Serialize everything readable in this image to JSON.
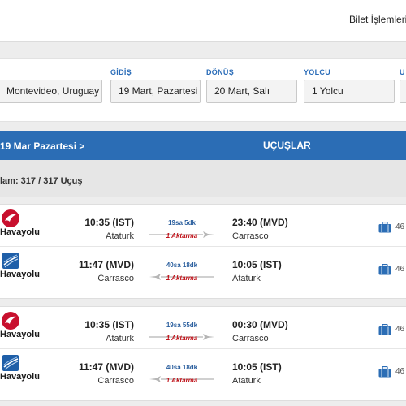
{
  "header": {
    "menu_label": "Bilet İşlemleri"
  },
  "search": {
    "from": {
      "value": "Montevideo, Uruguay (Carrasco)"
    },
    "depart": {
      "label": "GİDİŞ",
      "value": "19 Mart, Pazartesi"
    },
    "return": {
      "label": "DÖNÜŞ",
      "value": "20 Mart, Salı"
    },
    "passengers": {
      "label": "YOLCU",
      "value": "1 Yolcu"
    },
    "extra": {
      "label": "U"
    }
  },
  "results_header": {
    "date_text": "19 Mar Pazartesi  >",
    "title": "UÇUŞLAR"
  },
  "count_text": "lam: 317 / 317 Uçuş",
  "colors": {
    "brand_blue": "#2b6db5",
    "label_blue": "#2a6cb8",
    "stops_red": "#c0131a",
    "turkish_red": "#c8102e",
    "partner_blue": "#1f5fa8"
  },
  "cards": [
    {
      "legs": [
        {
          "airline": "Havayolu",
          "logo": "turkish-airlines-logo",
          "dep_time": "10:35 (IST)",
          "dep_city": "Ataturk",
          "duration": "19sa 5dk",
          "stops": "1 Aktarma",
          "direction": "outbound",
          "arr_time": "23:40 (MVD)",
          "arr_city": "Carrasco",
          "bag_icon": "baggage-icon",
          "bags": "46"
        },
        {
          "airline": "Havayolu",
          "logo": "partner-airline-logo",
          "dep_time": "11:47 (MVD)",
          "dep_city": "Carrasco",
          "duration": "40sa 18dk",
          "stops": "1 Aktarma",
          "direction": "return",
          "arr_time": "10:05 (IST)",
          "arr_city": "Ataturk",
          "bag_icon": "baggage-icon",
          "bags": "46"
        }
      ]
    },
    {
      "legs": [
        {
          "airline": "Havayolu",
          "logo": "turkish-airlines-logo",
          "dep_time": "10:35 (IST)",
          "dep_city": "Ataturk",
          "duration": "19sa 55dk",
          "stops": "1 Aktarma",
          "direction": "outbound",
          "arr_time": "00:30 (MVD)",
          "arr_city": "Carrasco",
          "bag_icon": "baggage-icon",
          "bags": "46"
        },
        {
          "airline": "Havayolu",
          "logo": "partner-airline-logo",
          "dep_time": "11:47 (MVD)",
          "dep_city": "Carrasco",
          "duration": "40sa 18dk",
          "stops": "1 Aktarma",
          "direction": "return",
          "arr_time": "10:05 (IST)",
          "arr_city": "Ataturk",
          "bag_icon": "baggage-icon",
          "bags": "46"
        }
      ]
    }
  ]
}
